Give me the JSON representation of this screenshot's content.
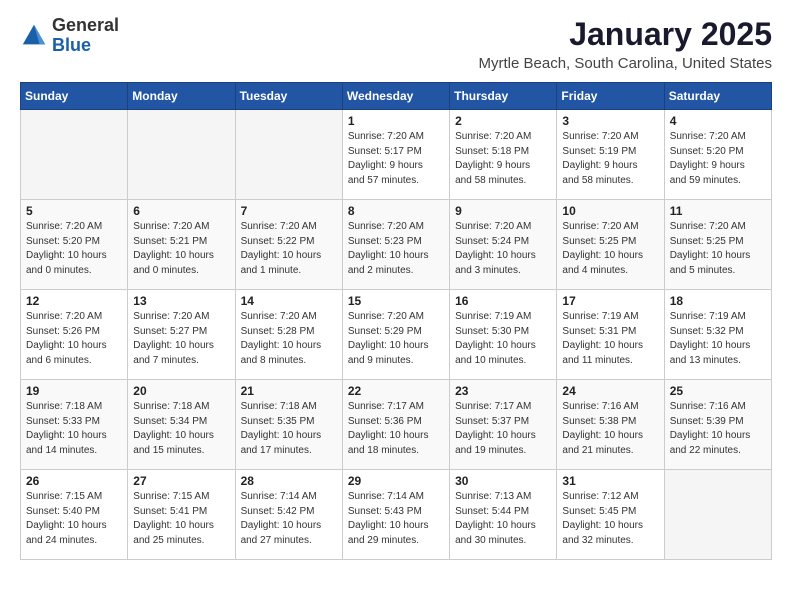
{
  "app": {
    "name": "GeneralBlue",
    "name1": "General",
    "name2": "Blue"
  },
  "title": "January 2025",
  "location": "Myrtle Beach, South Carolina, United States",
  "weekdays": [
    "Sunday",
    "Monday",
    "Tuesday",
    "Wednesday",
    "Thursday",
    "Friday",
    "Saturday"
  ],
  "weeks": [
    [
      {
        "day": "",
        "info": ""
      },
      {
        "day": "",
        "info": ""
      },
      {
        "day": "",
        "info": ""
      },
      {
        "day": "1",
        "info": "Sunrise: 7:20 AM\nSunset: 5:17 PM\nDaylight: 9 hours\nand 57 minutes."
      },
      {
        "day": "2",
        "info": "Sunrise: 7:20 AM\nSunset: 5:18 PM\nDaylight: 9 hours\nand 58 minutes."
      },
      {
        "day": "3",
        "info": "Sunrise: 7:20 AM\nSunset: 5:19 PM\nDaylight: 9 hours\nand 58 minutes."
      },
      {
        "day": "4",
        "info": "Sunrise: 7:20 AM\nSunset: 5:20 PM\nDaylight: 9 hours\nand 59 minutes."
      }
    ],
    [
      {
        "day": "5",
        "info": "Sunrise: 7:20 AM\nSunset: 5:20 PM\nDaylight: 10 hours\nand 0 minutes."
      },
      {
        "day": "6",
        "info": "Sunrise: 7:20 AM\nSunset: 5:21 PM\nDaylight: 10 hours\nand 0 minutes."
      },
      {
        "day": "7",
        "info": "Sunrise: 7:20 AM\nSunset: 5:22 PM\nDaylight: 10 hours\nand 1 minute."
      },
      {
        "day": "8",
        "info": "Sunrise: 7:20 AM\nSunset: 5:23 PM\nDaylight: 10 hours\nand 2 minutes."
      },
      {
        "day": "9",
        "info": "Sunrise: 7:20 AM\nSunset: 5:24 PM\nDaylight: 10 hours\nand 3 minutes."
      },
      {
        "day": "10",
        "info": "Sunrise: 7:20 AM\nSunset: 5:25 PM\nDaylight: 10 hours\nand 4 minutes."
      },
      {
        "day": "11",
        "info": "Sunrise: 7:20 AM\nSunset: 5:25 PM\nDaylight: 10 hours\nand 5 minutes."
      }
    ],
    [
      {
        "day": "12",
        "info": "Sunrise: 7:20 AM\nSunset: 5:26 PM\nDaylight: 10 hours\nand 6 minutes."
      },
      {
        "day": "13",
        "info": "Sunrise: 7:20 AM\nSunset: 5:27 PM\nDaylight: 10 hours\nand 7 minutes."
      },
      {
        "day": "14",
        "info": "Sunrise: 7:20 AM\nSunset: 5:28 PM\nDaylight: 10 hours\nand 8 minutes."
      },
      {
        "day": "15",
        "info": "Sunrise: 7:20 AM\nSunset: 5:29 PM\nDaylight: 10 hours\nand 9 minutes."
      },
      {
        "day": "16",
        "info": "Sunrise: 7:19 AM\nSunset: 5:30 PM\nDaylight: 10 hours\nand 10 minutes."
      },
      {
        "day": "17",
        "info": "Sunrise: 7:19 AM\nSunset: 5:31 PM\nDaylight: 10 hours\nand 11 minutes."
      },
      {
        "day": "18",
        "info": "Sunrise: 7:19 AM\nSunset: 5:32 PM\nDaylight: 10 hours\nand 13 minutes."
      }
    ],
    [
      {
        "day": "19",
        "info": "Sunrise: 7:18 AM\nSunset: 5:33 PM\nDaylight: 10 hours\nand 14 minutes."
      },
      {
        "day": "20",
        "info": "Sunrise: 7:18 AM\nSunset: 5:34 PM\nDaylight: 10 hours\nand 15 minutes."
      },
      {
        "day": "21",
        "info": "Sunrise: 7:18 AM\nSunset: 5:35 PM\nDaylight: 10 hours\nand 17 minutes."
      },
      {
        "day": "22",
        "info": "Sunrise: 7:17 AM\nSunset: 5:36 PM\nDaylight: 10 hours\nand 18 minutes."
      },
      {
        "day": "23",
        "info": "Sunrise: 7:17 AM\nSunset: 5:37 PM\nDaylight: 10 hours\nand 19 minutes."
      },
      {
        "day": "24",
        "info": "Sunrise: 7:16 AM\nSunset: 5:38 PM\nDaylight: 10 hours\nand 21 minutes."
      },
      {
        "day": "25",
        "info": "Sunrise: 7:16 AM\nSunset: 5:39 PM\nDaylight: 10 hours\nand 22 minutes."
      }
    ],
    [
      {
        "day": "26",
        "info": "Sunrise: 7:15 AM\nSunset: 5:40 PM\nDaylight: 10 hours\nand 24 minutes."
      },
      {
        "day": "27",
        "info": "Sunrise: 7:15 AM\nSunset: 5:41 PM\nDaylight: 10 hours\nand 25 minutes."
      },
      {
        "day": "28",
        "info": "Sunrise: 7:14 AM\nSunset: 5:42 PM\nDaylight: 10 hours\nand 27 minutes."
      },
      {
        "day": "29",
        "info": "Sunrise: 7:14 AM\nSunset: 5:43 PM\nDaylight: 10 hours\nand 29 minutes."
      },
      {
        "day": "30",
        "info": "Sunrise: 7:13 AM\nSunset: 5:44 PM\nDaylight: 10 hours\nand 30 minutes."
      },
      {
        "day": "31",
        "info": "Sunrise: 7:12 AM\nSunset: 5:45 PM\nDaylight: 10 hours\nand 32 minutes."
      },
      {
        "day": "",
        "info": ""
      }
    ]
  ]
}
